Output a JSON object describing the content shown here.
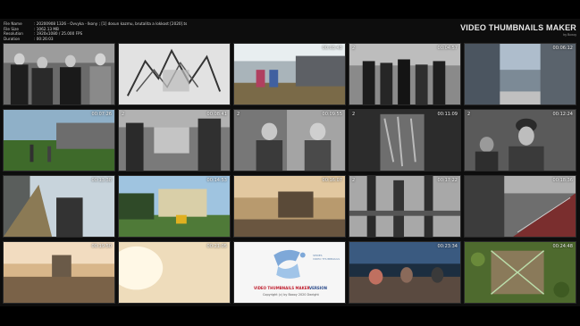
{
  "info": {
    "rows": [
      {
        "label": "File Name",
        "value": ": 20200908 1326 - Ovvyka - Ikony ; [1] dosun kazmu, brutalita a lokkost [2020].ts"
      },
      {
        "label": "File Size",
        "value": ": 1062.13 MB"
      },
      {
        "label": "Resolution",
        "value": ": 1920x1080 / 25.000 FPS"
      },
      {
        "label": "Duration",
        "value": ": 00:26:03"
      }
    ]
  },
  "brand": {
    "title": "VIDEO THUMBNAILS MAKER",
    "subtitle": "by Boxoy"
  },
  "thumbnails": [
    {
      "num": "",
      "ts": ""
    },
    {
      "num": "",
      "ts": ""
    },
    {
      "num": "",
      "ts": "00:03:43"
    },
    {
      "num": "2",
      "ts": "00:04:57"
    },
    {
      "num": "",
      "ts": "00:06:12"
    },
    {
      "num": "",
      "ts": "00:07:26"
    },
    {
      "num": "2",
      "ts": "00:08:41"
    },
    {
      "num": "2",
      "ts": "00:09:55"
    },
    {
      "num": "2",
      "ts": "00:11:09"
    },
    {
      "num": "2",
      "ts": "00:12:24"
    },
    {
      "num": "",
      "ts": "00:13:38"
    },
    {
      "num": "",
      "ts": "00:14:53"
    },
    {
      "num": "",
      "ts": "00:16:07"
    },
    {
      "num": "2",
      "ts": "00:17:22"
    },
    {
      "num": "",
      "ts": "00:18:36"
    },
    {
      "num": "",
      "ts": "00:19:50"
    },
    {
      "num": "",
      "ts": "00:21:05"
    },
    {
      "num": "",
      "ts": ""
    },
    {
      "num": "",
      "ts": "00:23:34"
    },
    {
      "num": "",
      "ts": "00:24:48"
    }
  ],
  "logo_card": {
    "name": "VIDEO THUMBNAILS MAKER",
    "version": "VERSION",
    "copyright": "Copyright (c) by Boxoy 2020 Dwright",
    "mark_text": "SERIES\nVIDEO THUMBNAILS"
  }
}
